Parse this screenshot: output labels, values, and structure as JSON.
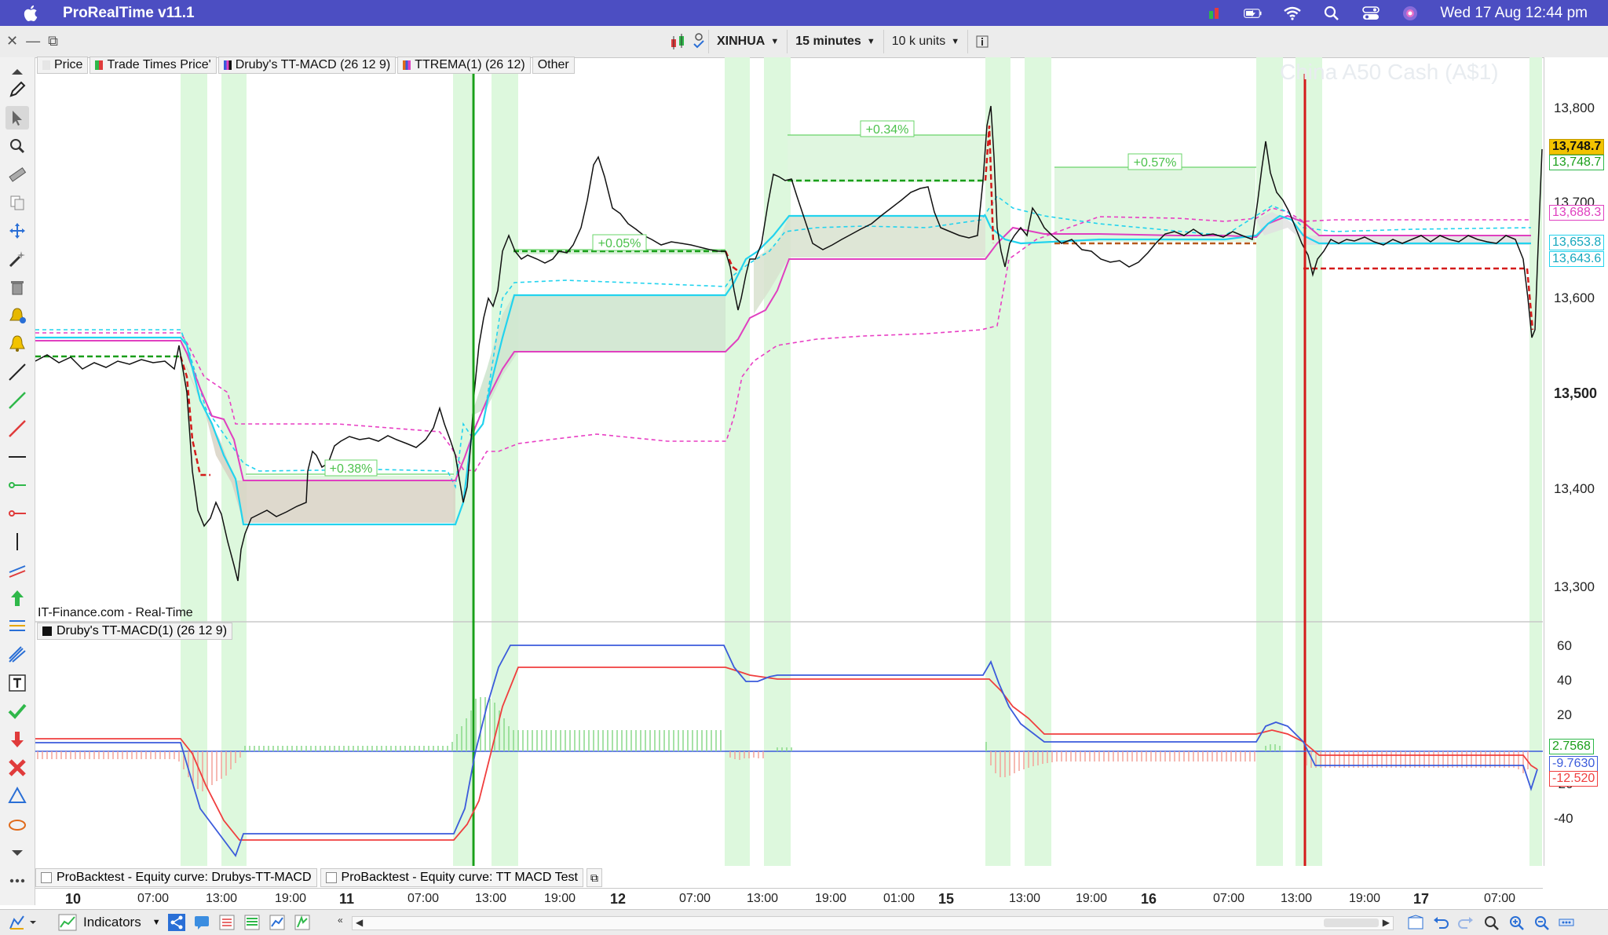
{
  "menubar": {
    "app_name": "ProRealTime v11.1",
    "datetime": "Wed 17 Aug  12:44 pm"
  },
  "toolbar": {
    "instrument": "XINHUA",
    "timeframe": "15 minutes",
    "units": "10 k units"
  },
  "legend": {
    "items": [
      "Price",
      "Trade Times Price'",
      "Druby's TT-MACD (26 12 9)",
      "TTREMA(1) (26 12)",
      "Other"
    ]
  },
  "watermark": "China A50 Cash (A$1)",
  "source": "IT-Finance.com - Real-Time",
  "macd_legend": "Druby's TT-MACD(1) (26 12 9)",
  "price_axis": {
    "ticks": [
      "13,800",
      "13,700",
      "13,600",
      "13,500",
      "13,400",
      "13,300"
    ],
    "badges": [
      "13,748.7",
      "13,748.7",
      "13,688.3",
      "13,653.8",
      "13,643.6"
    ]
  },
  "macd_axis": {
    "ticks": [
      "60",
      "40",
      "20",
      "-20",
      "-40"
    ],
    "badges": [
      "2.7568",
      "-9.7630",
      "-12.520"
    ]
  },
  "annotations": [
    "+0.38%",
    "+0.05%",
    "+0.34%",
    "+0.57%"
  ],
  "x_axis": {
    "labels": [
      "10",
      "07:00",
      "13:00",
      "19:00",
      "11",
      "07:00",
      "13:00",
      "19:00",
      "12",
      "07:00",
      "13:00",
      "19:00",
      "01:00",
      "15",
      "13:00",
      "19:00",
      "16",
      "07:00",
      "13:00",
      "19:00",
      "17",
      "07:00"
    ]
  },
  "bottom_tabs": [
    "ProBacktest - Equity curve: Drubys-TT-MACD",
    "ProBacktest - Equity curve: TT MACD Test"
  ],
  "statusbar": {
    "indicators_label": "Indicators"
  },
  "colors": {
    "menubar": "#4c4ec2",
    "macd_line": "#3b5bdb",
    "signal_line": "#f03e3e",
    "ema_cyan": "#22d3ee",
    "ema_magenta": "#e040c0",
    "session_shade": "#d9f7d9",
    "entry_line": "#1a9e1a",
    "exit_line": "#d41a1a"
  }
}
